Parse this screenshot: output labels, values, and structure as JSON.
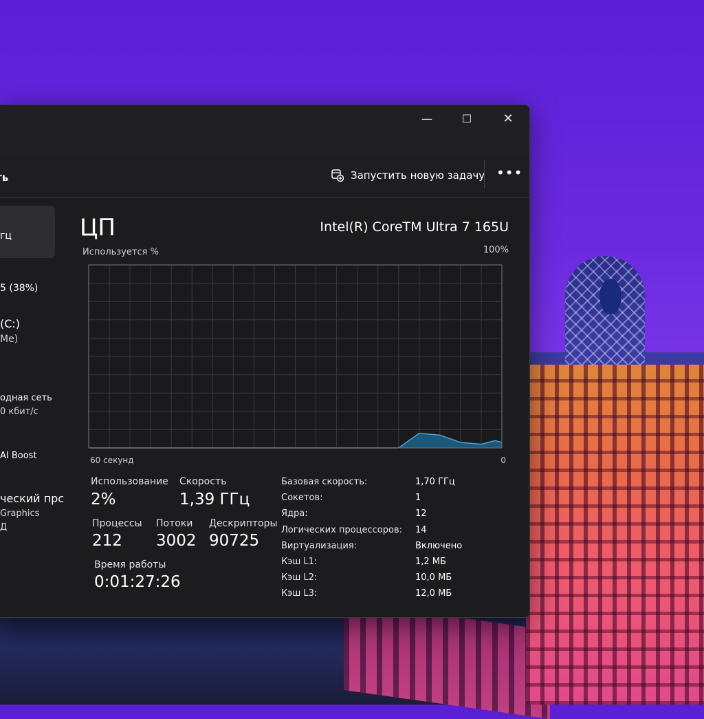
{
  "window": {
    "controls": {
      "minimize": "—",
      "maximize": "☐",
      "close": "✕"
    }
  },
  "cmdbar": {
    "page_title": "ть",
    "new_task_label": "Запустить новую задачу",
    "more_label": "•••"
  },
  "sidebar": {
    "items": [
      {
        "line1": "гц",
        "line2": ""
      },
      {
        "line1": "5 (38%)",
        "line2": ""
      },
      {
        "line1": "(C:)",
        "line2": "Me)"
      },
      {
        "line1": "одная сеть",
        "line2": "0 кбит/с"
      },
      {
        "line1": "AI Boost",
        "line2": ""
      },
      {
        "line1": "ческий прс",
        "line2": "Graphics",
        "line3": "Д"
      }
    ]
  },
  "main": {
    "title": "ЦП",
    "model": "Intel(R) CoreTM Ultra 7 165U",
    "usage_label": "Используется %",
    "max_label": "100%",
    "axis_left": "60 секунд",
    "axis_right": "0"
  },
  "stats": {
    "usage_label": "Использование",
    "usage_value": "2%",
    "speed_label": "Скорость",
    "speed_value": "1,39 ГГц",
    "processes_label": "Процессы",
    "processes_value": "212",
    "threads_label": "Потоки",
    "threads_value": "3002",
    "handles_label": "Дескрипторы",
    "handles_value": "90725",
    "uptime_label": "Время работы",
    "uptime_value": "0:01:27:26"
  },
  "specs": [
    {
      "label": "Базовая скорость:",
      "value": "1,70 ГГц"
    },
    {
      "label": "Сокетов:",
      "value": "1"
    },
    {
      "label": "Ядра:",
      "value": "12"
    },
    {
      "label": "Логических процессоров:",
      "value": "14"
    },
    {
      "label": "Виртуализация:",
      "value": "Включено"
    },
    {
      "label": "Кэш L1:",
      "value": "1,2 МБ"
    },
    {
      "label": "Кэш L2:",
      "value": "10,0 МБ"
    },
    {
      "label": "Кэш L3:",
      "value": "12,0 МБ"
    }
  ],
  "chart_data": {
    "type": "area",
    "x": [
      60,
      57,
      54,
      51,
      48,
      45,
      42,
      39,
      36,
      33,
      30,
      27,
      24,
      21,
      18,
      15,
      12,
      9,
      6,
      3,
      2,
      1,
      0
    ],
    "y": [
      0,
      0,
      0,
      0,
      0,
      0,
      0,
      0,
      0,
      0,
      0,
      0,
      0,
      0,
      0,
      0,
      8,
      7,
      3,
      2,
      3,
      4,
      3
    ],
    "xlim": [
      60,
      0
    ],
    "ylim": [
      0,
      100
    ],
    "grid": true,
    "colors": {
      "line": "#4aa3d6",
      "fill": "#1c5878",
      "grid": "#3a3a3e",
      "border": "#6b6b70"
    }
  }
}
